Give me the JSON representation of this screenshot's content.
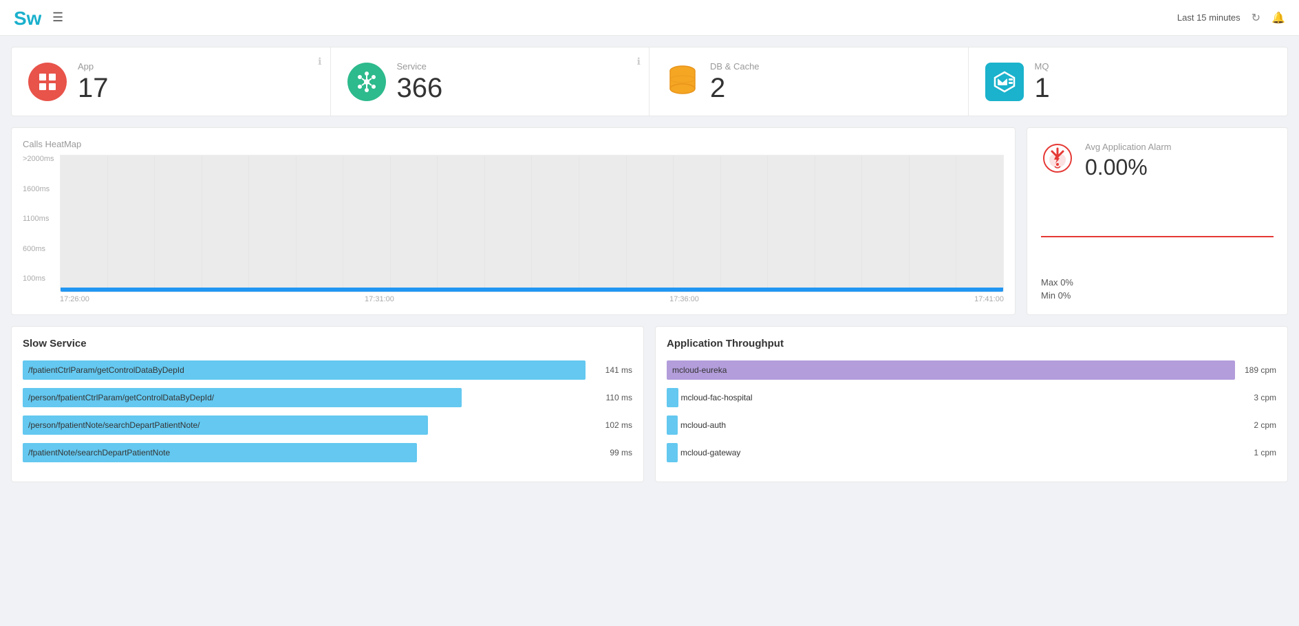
{
  "header": {
    "time_range": "Last 15 minutes",
    "menu_icon": "☰"
  },
  "cards": [
    {
      "id": "app",
      "label": "App",
      "value": "17",
      "icon_type": "app"
    },
    {
      "id": "service",
      "label": "Service",
      "value": "366",
      "icon_type": "service"
    },
    {
      "id": "db",
      "label": "DB & Cache",
      "value": "2",
      "icon_type": "db"
    },
    {
      "id": "mq",
      "label": "MQ",
      "value": "1",
      "icon_type": "mq"
    }
  ],
  "heatmap": {
    "title": "Calls HeatMap",
    "y_labels": [
      ">2000ms",
      "1600ms",
      "1100ms",
      "600ms",
      "100ms"
    ],
    "x_labels": [
      "17:26:00",
      "17:31:00",
      "17:36:00",
      "17:41:00"
    ]
  },
  "alarm": {
    "label": "Avg Application Alarm",
    "value": "0.00%",
    "max_label": "Max",
    "max_value": "0%",
    "min_label": "Min",
    "min_value": "0%"
  },
  "slow_service": {
    "title": "Slow Service",
    "items": [
      {
        "label": "/fpatientCtrlParam/getControlDataByDepId",
        "value": "141 ms",
        "pct": 100
      },
      {
        "label": "/person/fpatientCtrlParam/getControlDataByDepId/",
        "value": "110 ms",
        "pct": 78
      },
      {
        "label": "/person/fpatientNote/searchDepartPatientNote/",
        "value": "102 ms",
        "pct": 72
      },
      {
        "label": "/fpatientNote/searchDepartPatientNote",
        "value": "99 ms",
        "pct": 70
      }
    ]
  },
  "throughput": {
    "title": "Application Throughput",
    "items": [
      {
        "label": "mcloud-eureka",
        "value": "189 cpm",
        "pct": 100,
        "highlighted": true
      },
      {
        "label": "mcloud-fac-hospital",
        "value": "3 cpm",
        "pct": 2
      },
      {
        "label": "mcloud-auth",
        "value": "2 cpm",
        "pct": 1
      },
      {
        "label": "mcloud-gateway",
        "value": "1 cpm",
        "pct": 0.5
      }
    ]
  }
}
